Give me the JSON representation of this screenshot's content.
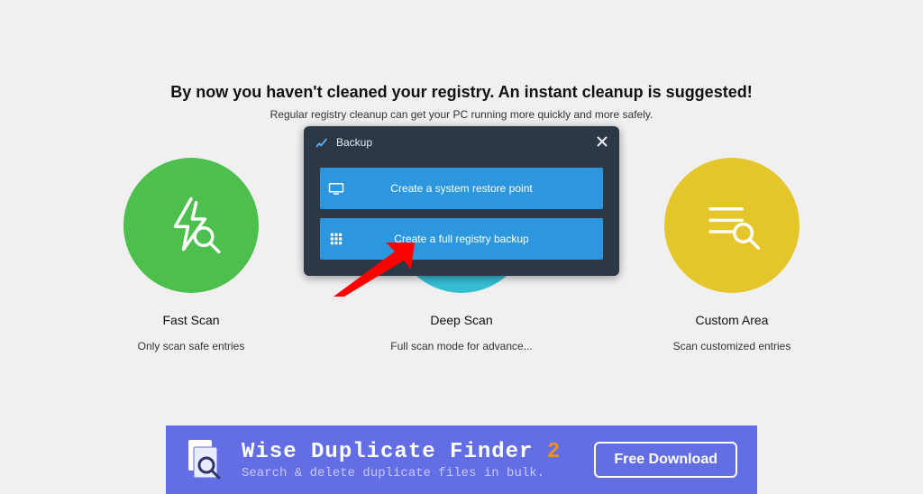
{
  "headline": "By now you haven't cleaned your registry. An instant cleanup is suggested!",
  "subtext": "Regular registry cleanup can get your PC running more quickly and more safely.",
  "scan_options": {
    "fast": {
      "title": "Fast Scan",
      "desc": "Only scan safe entries"
    },
    "deep": {
      "title": "Deep Scan",
      "desc": "Full scan mode for advance..."
    },
    "custom": {
      "title": "Custom Area",
      "desc": "Scan customized entries"
    }
  },
  "backup_dialog": {
    "title": "Backup",
    "option_restore_point": "Create a system restore point",
    "option_full_backup": "Create a full registry backup"
  },
  "ad": {
    "title_prefix": "Wise Duplicate Finder ",
    "title_number": "2",
    "subtitle": "Search & delete duplicate files in bulk.",
    "button": "Free Download"
  }
}
